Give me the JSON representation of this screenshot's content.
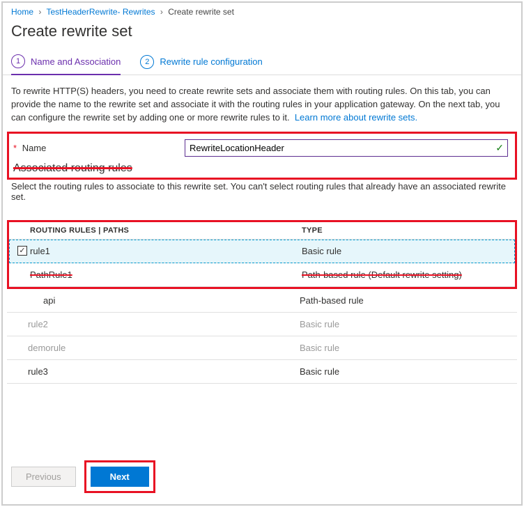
{
  "breadcrumb": {
    "home": "Home",
    "parent": "TestHeaderRewrite- Rewrites",
    "current": "Create rewrite set"
  },
  "page_title": "Create rewrite set",
  "tabs": {
    "t1": {
      "num": "1",
      "label": "Name and Association"
    },
    "t2": {
      "num": "2",
      "label": "Rewrite rule configuration"
    }
  },
  "description": "To rewrite HTTP(S) headers, you need to create rewrite sets and associate them with routing rules. On this tab, you can provide the name to the rewrite set and associate it with the routing rules in your application gateway. On the next tab, you can configure the rewrite set by adding one or more rewrite rules to it.",
  "learn_more": "Learn more about rewrite sets.",
  "name_field": {
    "label": "Name",
    "value": "RewriteLocationHeader"
  },
  "section": {
    "title": "Associated routing rules",
    "desc": "Select the routing rules to associate to this rewrite set. You can't select routing rules that already have an associated rewrite set."
  },
  "table": {
    "col_rules": "ROUTING RULES | PATHS",
    "col_type": "TYPE",
    "rows": [
      {
        "checked": true,
        "name": "rule1",
        "type": "Basic rule",
        "state": "selected"
      },
      {
        "checked": false,
        "name": "PathRule1",
        "type": "Path-based rule (Default rewrite setting)",
        "state": "struck"
      },
      {
        "checked": false,
        "name": "api",
        "type": "Path-based rule",
        "state": "indent"
      },
      {
        "checked": false,
        "name": "rule2",
        "type": "Basic rule",
        "state": "dim"
      },
      {
        "checked": false,
        "name": "demorule",
        "type": "Basic rule",
        "state": "dim"
      },
      {
        "checked": false,
        "name": "rule3",
        "type": "Basic rule",
        "state": "normal"
      }
    ]
  },
  "footer": {
    "previous": "Previous",
    "next": "Next"
  }
}
